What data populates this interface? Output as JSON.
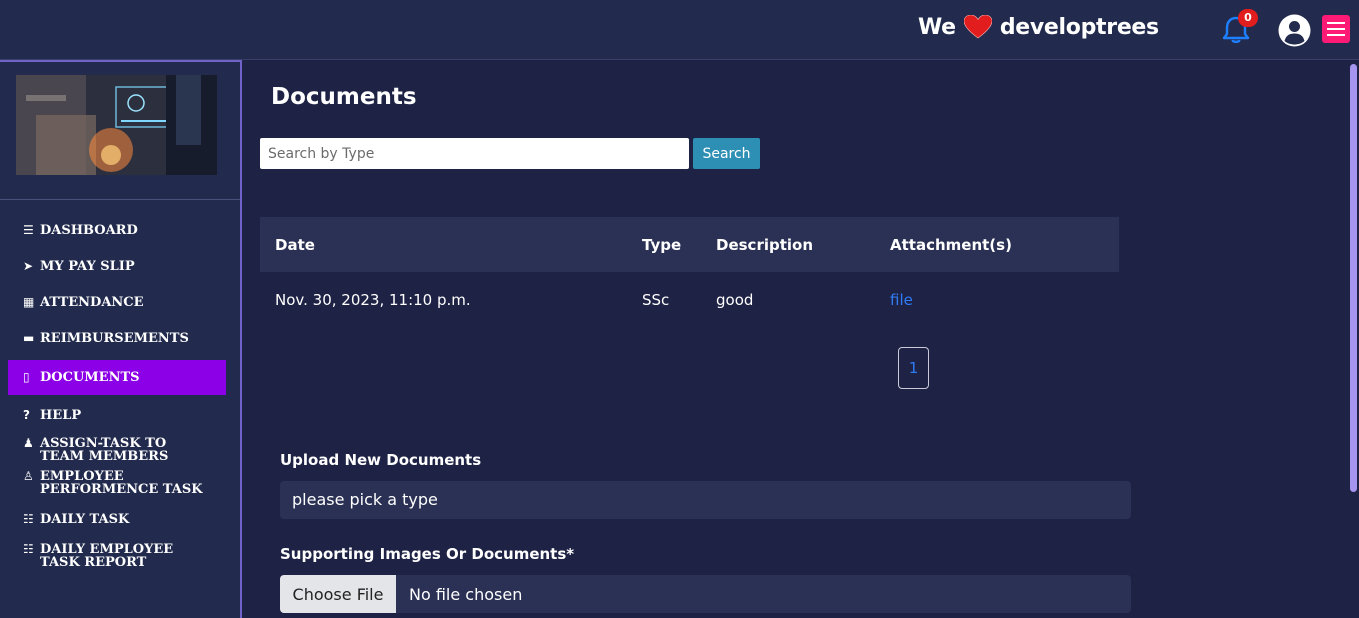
{
  "topbar": {
    "brand_prefix": "We",
    "brand_name": "developtrees",
    "notification_count": "0",
    "heart_color": "#e11d1d",
    "menu_button_color": "#ff1a75"
  },
  "sidebar": {
    "items": [
      {
        "label": "DASHBOARD",
        "icon": "list-icon",
        "glyph": "☰"
      },
      {
        "label": "MY PAY SLIP",
        "icon": "paper-plane-icon",
        "glyph": "➤"
      },
      {
        "label": "ATTENDANCE",
        "icon": "calendar-icon",
        "glyph": "▦"
      },
      {
        "label": "REIMBURSEMENTS",
        "icon": "credit-card-icon",
        "glyph": "▬"
      },
      {
        "label": "DOCUMENTS",
        "icon": "file-icon",
        "glyph": "▯",
        "active": true
      },
      {
        "label": "HELP",
        "icon": "question-circle-icon",
        "glyph": "?"
      },
      {
        "label": "ASSIGN-TASK TO TEAM MEMBERS",
        "icon": "users-icon",
        "glyph": "♟"
      },
      {
        "label": "EMPLOYEE PERFORMENCE TASK",
        "icon": "user-edit-icon",
        "glyph": "♙"
      },
      {
        "label": "DAILY TASK",
        "icon": "tasks-icon",
        "glyph": "☷"
      },
      {
        "label": "DAILY EMPLOYEE TASK REPORT",
        "icon": "tasks-icon",
        "glyph": "☷"
      }
    ],
    "active_color": "#8b00e6"
  },
  "main": {
    "title": "Documents",
    "search": {
      "placeholder": "Search by Type",
      "button_label": "Search"
    },
    "table": {
      "headers": [
        "Date",
        "Type",
        "Description",
        "Attachment(s)"
      ],
      "rows": [
        {
          "date": "Nov. 30, 2023, 11:10 p.m.",
          "type": "SSc",
          "description": "good",
          "attachment": "file"
        }
      ]
    },
    "pagination": {
      "current_page": "1"
    },
    "upload": {
      "label": "Upload New Documents",
      "type_select_value": "please pick a type",
      "supporting_label": "Supporting Images Or Documents*",
      "file_button_label": "Choose File",
      "file_status": "No file chosen"
    }
  }
}
